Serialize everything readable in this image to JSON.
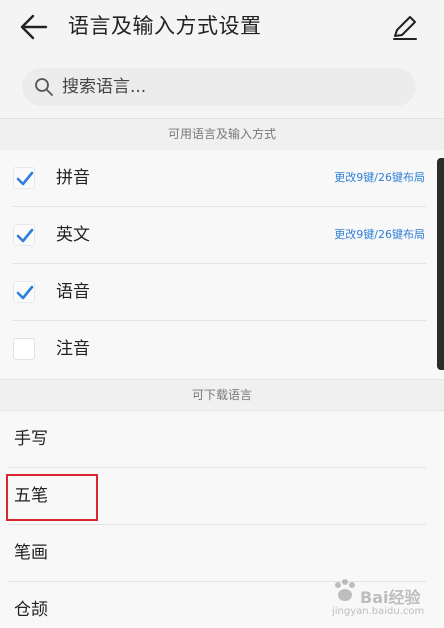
{
  "header": {
    "title": "语言及输入方式设置",
    "back_icon": "arrow-left-icon",
    "edit_icon": "pencil-icon"
  },
  "search": {
    "placeholder": "搜索语言...",
    "icon": "search-icon"
  },
  "section_available": {
    "title": "可用语言及输入方式"
  },
  "languages": [
    {
      "label": "拼音",
      "checked": true,
      "action": "更改9键/26键布局"
    },
    {
      "label": "英文",
      "checked": true,
      "action": "更改9键/26键布局"
    },
    {
      "label": "语音",
      "checked": true,
      "action": ""
    },
    {
      "label": "注音",
      "checked": false,
      "action": ""
    }
  ],
  "section_download": {
    "title": "可下载语言"
  },
  "downloadable": [
    {
      "label": "手写"
    },
    {
      "label": "五笔"
    },
    {
      "label": "笔画"
    },
    {
      "label": "仓颉"
    }
  ],
  "watermark": {
    "brand": "Bai经验",
    "sub": "jingyan.baidu.com"
  },
  "colors": {
    "accent": "#2f7fd8",
    "highlight_box": "#d8262f",
    "check": "#2f7fd8"
  }
}
